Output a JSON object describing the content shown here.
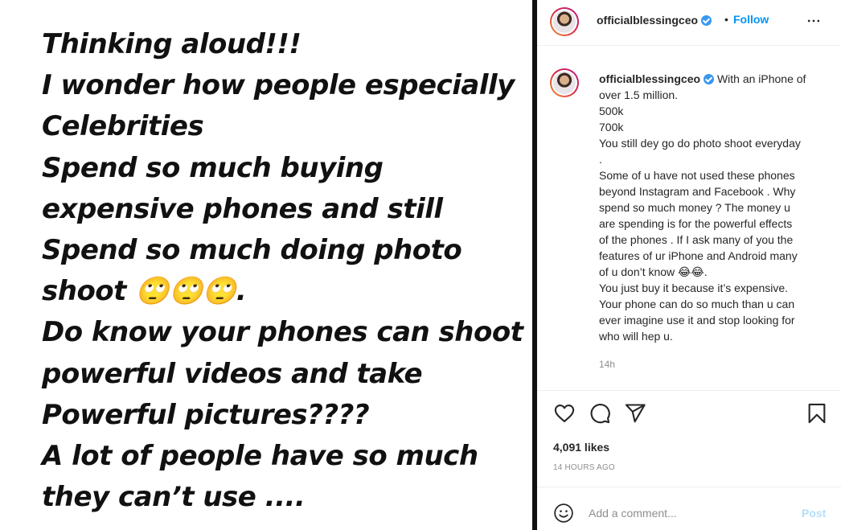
{
  "post_image": {
    "lines": [
      "Thinking aloud!!!",
      "I wonder how people especially",
      "Celebrities",
      "Spend so much buying",
      "expensive phones and still",
      "Spend so much doing photo",
      "shoot 🙄🙄🙄.",
      "Do know your phones can shoot",
      "powerful videos and take",
      "Powerful pictures????",
      "A lot of people have so much",
      "they can’t use ...."
    ]
  },
  "header": {
    "username": "officialblessingceo",
    "separator": "•",
    "follow_label": "Follow"
  },
  "caption": {
    "username": "officialblessingceo",
    "first_line": "With an iPhone of",
    "lines": [
      "over 1.5 million.",
      "500k",
      "700k",
      "You still dey go do photo shoot everyday",
      ".",
      "Some of u have not used these phones",
      "beyond Instagram and Facebook . Why",
      "spend so much money ? The money u",
      "are spending is for the powerful effects",
      "of the phones . If I ask many of you the",
      "features of ur iPhone and Android many",
      "of u don’t know 😂😂.",
      "You just buy it because it’s expensive.",
      "Your phone can do so much than u can",
      "ever imagine use it and stop looking for",
      "who will hep u."
    ],
    "time": "14h"
  },
  "stats": {
    "likes": "4,091 likes",
    "posted_time": "14 HOURS AGO"
  },
  "comment_box": {
    "placeholder": "Add a comment...",
    "post_label": "Post"
  },
  "icons": {
    "more": "more-options-icon",
    "like": "heart-icon",
    "comment": "comment-icon",
    "share": "share-icon",
    "save": "bookmark-icon",
    "emoji": "emoji-icon",
    "verified": "verified-badge-icon"
  },
  "colors": {
    "accent": "#0095f6",
    "verified": "#3897f0",
    "muted_text": "#8e8e8e",
    "post_disabled": "#b2dffc"
  }
}
